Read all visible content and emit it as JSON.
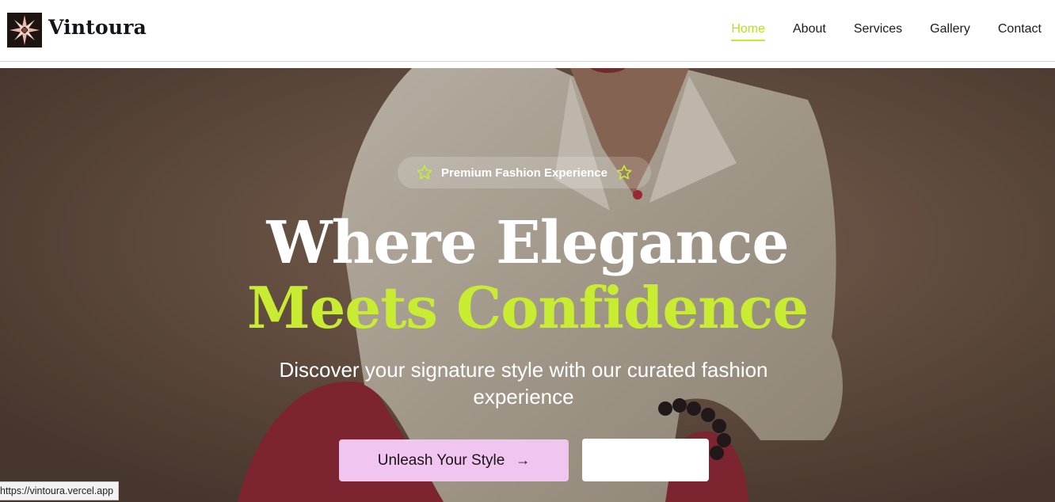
{
  "brand": {
    "name": "Vintoura",
    "logo_icon": "starburst-logo"
  },
  "nav": {
    "items": [
      {
        "label": "Home",
        "active": true
      },
      {
        "label": "About",
        "active": false
      },
      {
        "label": "Services",
        "active": false
      },
      {
        "label": "Gallery",
        "active": false
      },
      {
        "label": "Contact",
        "active": false
      }
    ]
  },
  "hero": {
    "badge": "Premium Fashion Experience",
    "headline_line1": "Where Elegance",
    "headline_line2": "Meets Confidence",
    "subtitle": "Discover your signature style with our curated fashion experience",
    "primary_cta": "Unleash Your Style",
    "primary_cta_icon": "arrow-right-icon",
    "secondary_cta": ""
  },
  "status_bar": {
    "url": "https://vintoura.vercel.app"
  },
  "colors": {
    "accent": "#c7ec32",
    "nav_active": "#b6e21a",
    "primary_button": "#f0c5ef",
    "text_dark": "#14141c"
  }
}
